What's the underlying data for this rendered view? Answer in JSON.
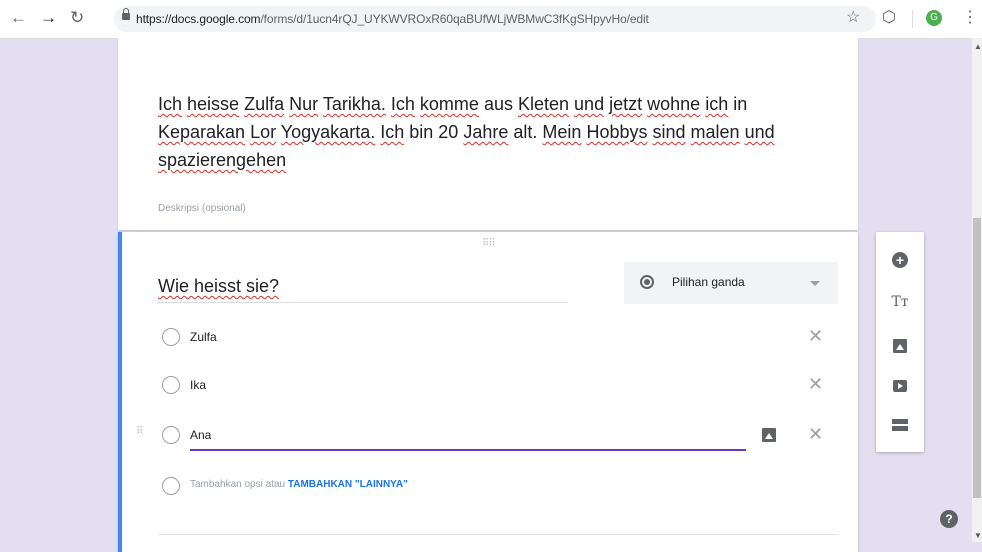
{
  "browser": {
    "url_host": "https://docs.google.com",
    "url_path": "/forms/d/1ucn4rQJ_UYKWVROxR60qaBUfWLjWBMwC3fKgSHpyvHo/edit",
    "avatar_letter": "G",
    "avatar_color": "#4caf50"
  },
  "form": {
    "description": "Ich heisse Zulfa Nur Tarikha. Ich komme aus Kleten und jetzt wohne ich in Keparakan Lor Yogyakarta. Ich bin 20 Jahre alt. Mein Hobbys sind malen und spazierengehen",
    "description_placeholder": "Deskripsi (opsional)"
  },
  "question": {
    "title": "Wie heisst sie?",
    "type_label": "Pilihan ganda",
    "options": [
      {
        "label": "Zulfa"
      },
      {
        "label": "Ika"
      },
      {
        "label": "Ana"
      }
    ],
    "add_option_text": "Tambahkan opsi",
    "add_or_text": "atau",
    "add_other_link": "TAMBAHKAN \"LAINNYA\""
  },
  "colors": {
    "accent_blue": "#4285f4",
    "active_underline": "#673ab7",
    "page_bg": "#e4dff0"
  }
}
